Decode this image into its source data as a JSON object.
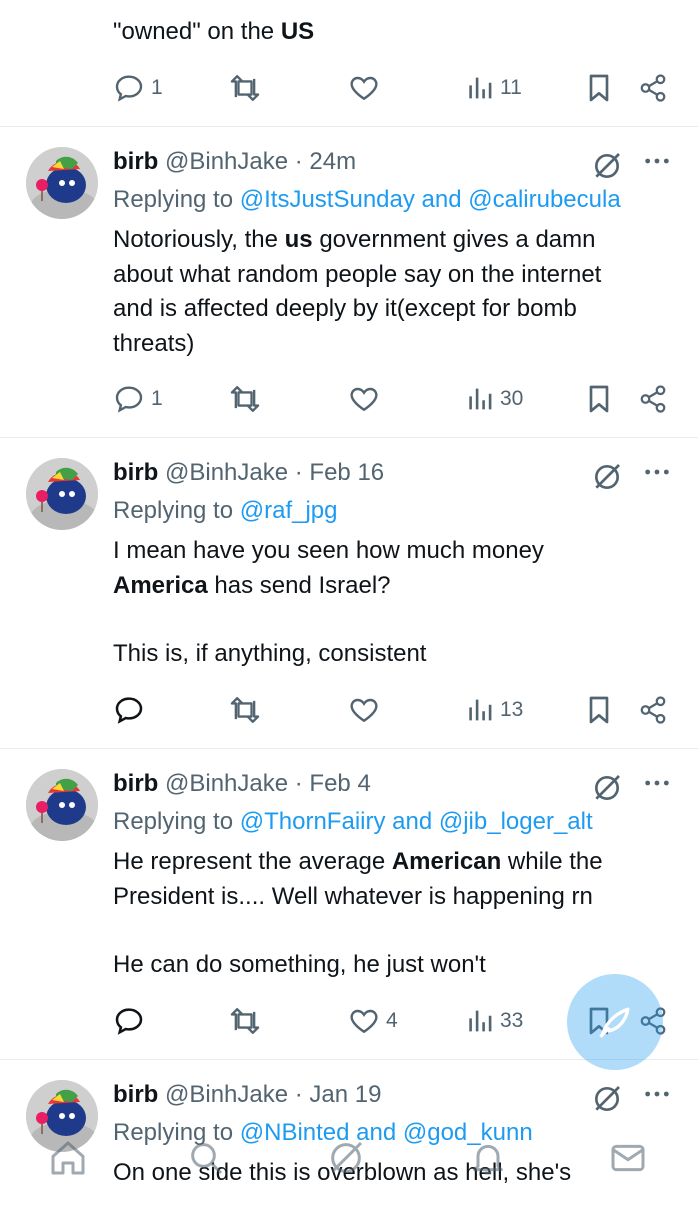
{
  "first_tweet": {
    "text_pre": "\"owned\" on the ",
    "text_bold": "US",
    "actions": {
      "replies": "1",
      "retweets": "",
      "likes": "",
      "views": "11"
    }
  },
  "tweets": [
    {
      "name": "birb",
      "handle": "@BinhJake",
      "time": "· 24m",
      "reply_prefix": "Replying to ",
      "reply_mentions": "@ItsJustSunday and @calirubecula",
      "body_lines": [
        [
          "Notoriously, the ",
          "us",
          " government gives a damn"
        ],
        [
          "about what random people say on the internet",
          "",
          ""
        ],
        [
          "and is affected deeply by it(except for bomb",
          "",
          ""
        ],
        [
          "threats)",
          "",
          ""
        ]
      ],
      "actions": {
        "replies": "1",
        "retweets": "",
        "likes": "",
        "views": "30"
      }
    },
    {
      "name": "birb",
      "handle": "@BinhJake",
      "time": "· Feb 16",
      "reply_prefix": "Replying to ",
      "reply_mentions": "@raf_jpg",
      "para1_line1": "I mean have you seen how much money",
      "para1_bold": "America",
      "para1_rest": " has send Israel?",
      "para2": "This is, if anything, consistent",
      "actions": {
        "replies": "",
        "retweets": "",
        "likes": "",
        "views": "13"
      }
    },
    {
      "name": "birb",
      "handle": "@BinhJake",
      "time": "· Feb 4",
      "reply_prefix": "Replying to ",
      "reply_mentions": "@ThornFaiiry and @jib_loger_alt",
      "line1_pre": "He represent the average ",
      "line1_bold": "American",
      "line1_post": " while the",
      "line2": "President is.... Well whatever is happening rn",
      "para2": "He can do something, he just won't",
      "actions": {
        "replies": "",
        "retweets": "",
        "likes": "4",
        "views": "33"
      }
    },
    {
      "name": "birb",
      "handle": "@BinhJake",
      "time": "· Jan 19",
      "reply_prefix": "Replying to ",
      "reply_mentions": "@NBinted and @god_kunn",
      "line1": "On one side this is overblown as hell, she's"
    }
  ],
  "colors": {
    "accent": "#1d9bf0",
    "muted": "#536471",
    "text": "#0f1419",
    "divider": "#e6ecf0"
  },
  "nav": [
    "home-icon",
    "search-icon",
    "grok-icon",
    "notifications-icon",
    "messages-icon"
  ]
}
